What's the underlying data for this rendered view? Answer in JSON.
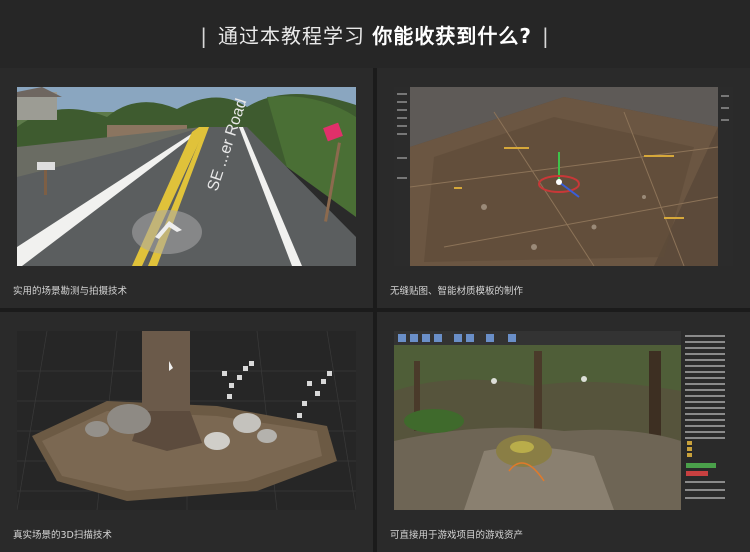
{
  "header": {
    "bar_left": "|",
    "title_normal": "通过本教程学习",
    "title_bold": "你能收获到什么?",
    "bar_right": "|"
  },
  "cards": [
    {
      "caption": "实用的场景勘测与拍摄技术",
      "road_sign_text": "SE ...er Road"
    },
    {
      "caption": "无缝贴图、智能材质模板的制作"
    },
    {
      "caption": "真实场景的3D扫描技术"
    },
    {
      "caption": "可直接用于游戏项目的游戏资产"
    }
  ],
  "colors": {
    "page_bg": "#1b1b1b",
    "header_bg": "#262626",
    "card_bg": "#2a2a2a",
    "caption_text": "#d6d6d6"
  }
}
